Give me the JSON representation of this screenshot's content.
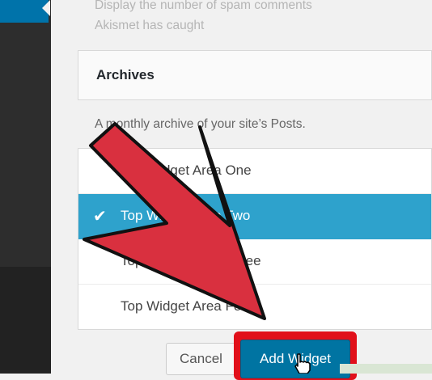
{
  "akismet": {
    "description": "Display the number of spam comments Akismet has caught"
  },
  "archives_widget": {
    "title": "Archives",
    "description": "A monthly archive of your site’s Posts."
  },
  "widget_areas": [
    {
      "label": "Top Widget Area One",
      "selected": false
    },
    {
      "label": "Top Widget Area Two",
      "selected": true
    },
    {
      "label": "Top Widget Area Three",
      "selected": false
    },
    {
      "label": "Top Widget Area Four",
      "selected": false
    }
  ],
  "buttons": {
    "cancel": "Cancel",
    "add": "Add Widget"
  },
  "colors": {
    "selected_row": "#2ea2cc",
    "primary_button": "#0074a2",
    "highlight_border": "#e1101a",
    "arrow_fill": "#d9303f",
    "sidebar": "#2d2d2d"
  }
}
